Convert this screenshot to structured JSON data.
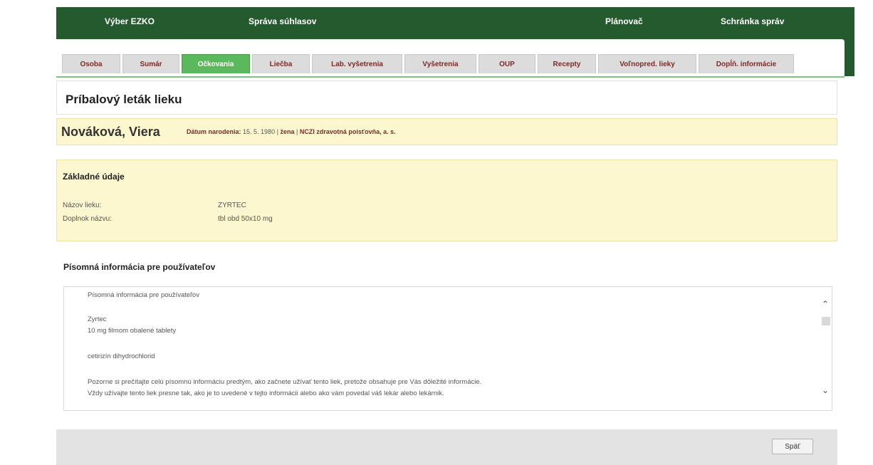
{
  "topnav": {
    "items": [
      {
        "label": "Výber EZKO"
      },
      {
        "label": "Správa súhlasov"
      },
      {
        "label": "Plánovač"
      },
      {
        "label": "Schránka správ"
      }
    ]
  },
  "tabs": [
    {
      "label": "Osoba"
    },
    {
      "label": "Sumár"
    },
    {
      "label": "Očkovania",
      "active": true
    },
    {
      "label": "Liečba"
    },
    {
      "label": "Lab. vyšetrenia"
    },
    {
      "label": "Vyšetrenia"
    },
    {
      "label": "OUP"
    },
    {
      "label": "Recepty"
    },
    {
      "label": "Voľnopred. lieky"
    },
    {
      "label": "Dopĺň. informácie"
    }
  ],
  "page": {
    "title": "Príbalový leták lieku"
  },
  "patient": {
    "name": "Nováková, Viera",
    "dob_label": "Dátum narodenia:",
    "dob_value": "15. 5. 1980",
    "sep1": "|",
    "gender": "žena",
    "sep2": "|",
    "insurer": "NCZI zdravotná poisťovňa, a. s."
  },
  "basic": {
    "title": "Základné údaje",
    "rows": [
      {
        "label": "Názov lieku:",
        "value": "ZYRTEC"
      },
      {
        "label": "Doplnok názvu:",
        "value": "tbl obd 50x10 mg"
      }
    ]
  },
  "info": {
    "title": "Písomná informácia pre používateľov",
    "lines": [
      "Písomná informácia pre používateľov",
      "Zyrtec",
      "10 mg filmom obalené tablety",
      "cetirizín dihydrochlorid",
      "Pozorne si prečítajte celú písomnú informáciu predtým, ako začnete užívať tento liek, pretože obsahuje pre Vás dôležité informácie.",
      "Vždy užívajte tento liek presne tak, ako je to uvedené v tejto informácii alebo ako vám povedal váš lekár alebo lekárnik."
    ]
  },
  "footer": {
    "back_label": "Späť"
  },
  "colors": {
    "header_green": "#255a2e",
    "active_tab": "#5cb85c",
    "patient_bg": "#fdf7cf",
    "footer_bg": "#e3e3e3"
  }
}
